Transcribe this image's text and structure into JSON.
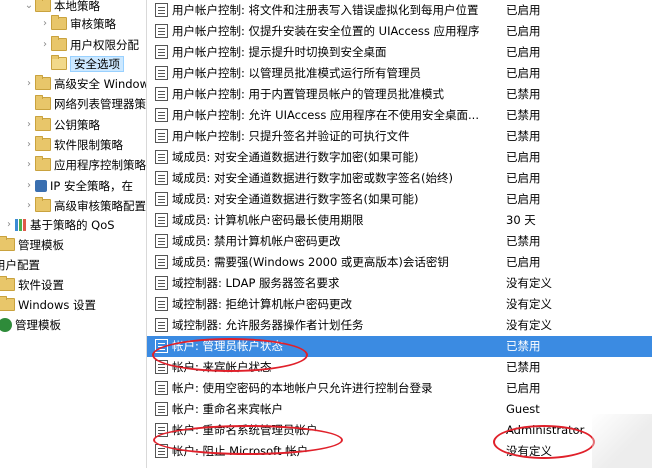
{
  "tree": {
    "items": [
      {
        "label": "本地策略",
        "indent": 1,
        "icon": "folder-icon",
        "expander": "⌄"
      },
      {
        "label": "审核策略",
        "indent": 2,
        "icon": "folder-icon",
        "expander": "›"
      },
      {
        "label": "用户权限分配",
        "indent": 2,
        "icon": "folder-icon",
        "expander": "›"
      },
      {
        "label": "安全选项",
        "indent": 2,
        "icon": "folder-icon",
        "expander": "",
        "selected": true
      },
      {
        "label": "高级安全 Windows",
        "indent": 1,
        "icon": "folder-icon",
        "expander": "›"
      },
      {
        "label": "网络列表管理器策略",
        "indent": 1,
        "icon": "folder-icon",
        "expander": ""
      },
      {
        "label": "公钥策略",
        "indent": 1,
        "icon": "folder-icon",
        "expander": "›"
      },
      {
        "label": "软件限制策略",
        "indent": 1,
        "icon": "folder-icon",
        "expander": "›"
      },
      {
        "label": "应用程序控制策略",
        "indent": 1,
        "icon": "folder-icon",
        "expander": "›"
      },
      {
        "label": "IP 安全策略，在",
        "indent": 1,
        "icon": "ipsec-icon",
        "expander": "›"
      },
      {
        "label": "高级审核策略配置",
        "indent": 1,
        "icon": "folder-icon",
        "expander": "›"
      },
      {
        "label": "基于策略的 QoS",
        "indent": 0,
        "icon": "chart-icon",
        "expander": "›"
      },
      {
        "label": "管理模板",
        "indent": -1,
        "icon": "folder-icon",
        "expander": "›"
      },
      {
        "label": "用户配置",
        "indent": -2,
        "icon": "",
        "expander": ""
      },
      {
        "label": "软件设置",
        "indent": -1,
        "icon": "folder-icon",
        "expander": "›"
      },
      {
        "label": "Windows 设置",
        "indent": -1,
        "icon": "folder-icon",
        "expander": "›"
      },
      {
        "label": "管理模板",
        "indent": -1,
        "icon": "green-icon",
        "expander": "›"
      }
    ]
  },
  "policies": [
    {
      "name": "用户帐户控制: 将文件和注册表写入错误虚拟化到每用户位置",
      "value": "已启用"
    },
    {
      "name": "用户帐户控制: 仅提升安装在安全位置的 UIAccess 应用程序",
      "value": "已启用"
    },
    {
      "name": "用户帐户控制: 提示提升时切换到安全桌面",
      "value": "已启用"
    },
    {
      "name": "用户帐户控制: 以管理员批准模式运行所有管理员",
      "value": "已启用"
    },
    {
      "name": "用户帐户控制: 用于内置管理员帐户的管理员批准模式",
      "value": "已禁用"
    },
    {
      "name": "用户帐户控制: 允许 UIAccess 应用程序在不使用安全桌面...",
      "value": "已禁用"
    },
    {
      "name": "用户帐户控制: 只提升签名并验证的可执行文件",
      "value": "已禁用"
    },
    {
      "name": "域成员: 对安全通道数据进行数字加密(如果可能)",
      "value": "已启用"
    },
    {
      "name": "域成员: 对安全通道数据进行数字加密或数字签名(始终)",
      "value": "已启用"
    },
    {
      "name": "域成员: 对安全通道数据进行数字签名(如果可能)",
      "value": "已启用"
    },
    {
      "name": "域成员: 计算机帐户密码最长使用期限",
      "value": "30 天"
    },
    {
      "name": "域成员: 禁用计算机帐户密码更改",
      "value": "已禁用"
    },
    {
      "name": "域成员: 需要强(Windows 2000 或更高版本)会话密钥",
      "value": "已启用"
    },
    {
      "name": "域控制器: LDAP 服务器签名要求",
      "value": "没有定义"
    },
    {
      "name": "域控制器: 拒绝计算机帐户密码更改",
      "value": "没有定义"
    },
    {
      "name": "域控制器: 允许服务器操作者计划任务",
      "value": "没有定义"
    },
    {
      "name": "帐户: 管理员帐户状态",
      "value": "已禁用",
      "selected": true
    },
    {
      "name": "帐户: 来宾帐户状态",
      "value": "已禁用"
    },
    {
      "name": "帐户: 使用空密码的本地帐户只允许进行控制台登录",
      "value": "已启用"
    },
    {
      "name": "帐户: 重命名来宾帐户",
      "value": "Guest"
    },
    {
      "name": "帐户: 重命名系统管理员帐户",
      "value": "Administrator"
    },
    {
      "name": "帐户: 阻止 Microsoft 帐户",
      "value": "没有定义"
    }
  ]
}
